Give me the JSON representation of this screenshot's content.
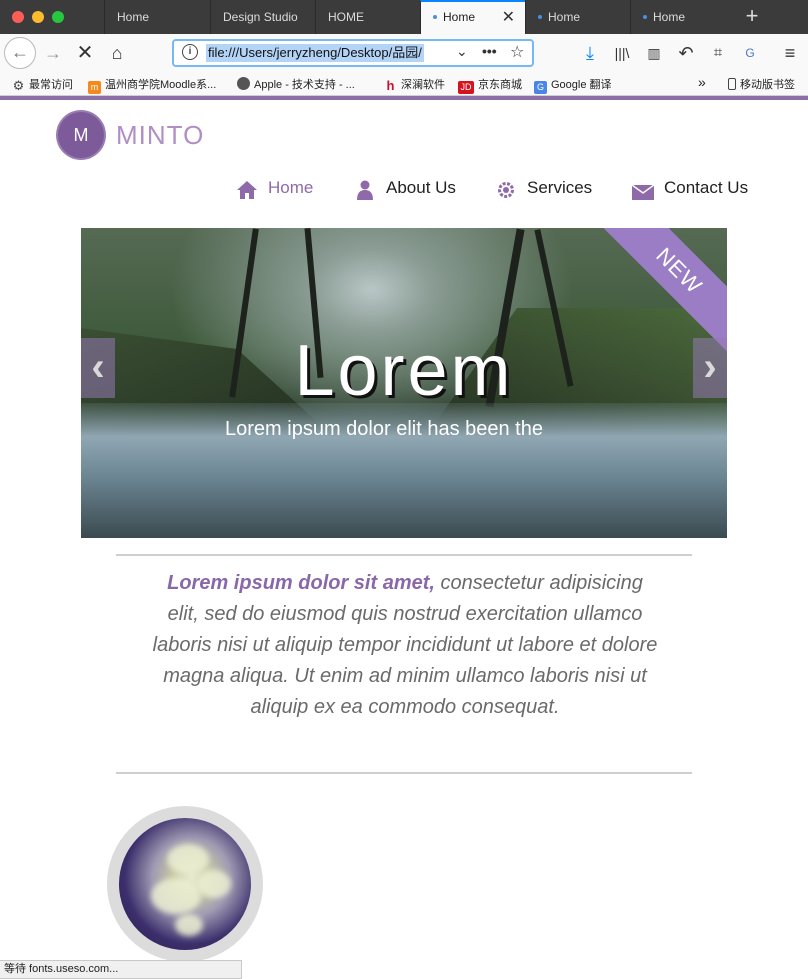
{
  "browser": {
    "tabs": [
      {
        "label": "Home",
        "active": false,
        "dot": false
      },
      {
        "label": "Design Studio",
        "active": false,
        "dot": false
      },
      {
        "label": "HOME",
        "active": false,
        "dot": false
      },
      {
        "label": "Home",
        "active": true,
        "dot": true
      },
      {
        "label": "Home",
        "active": false,
        "dot": true
      },
      {
        "label": "Home",
        "active": false,
        "dot": true
      }
    ],
    "url": "file:///Users/jerryzheng/Desktop/品园/",
    "bookmarks": [
      {
        "label": "最常访问",
        "icon": "gear-icon"
      },
      {
        "label": "温州商学院Moodle系...",
        "icon": "moodle-icon"
      },
      {
        "label": "Apple - 技术支持 - ...",
        "icon": "apple-icon"
      },
      {
        "label": "深澜软件",
        "icon": "h-icon"
      },
      {
        "label": "京东商城",
        "icon": "jd-icon"
      },
      {
        "label": "Google 翻译",
        "icon": "google-translate-icon"
      }
    ],
    "mobile_bookmarks": "移动版书签",
    "status": "等待 fonts.useso.com..."
  },
  "site": {
    "logo_letter": "M",
    "logo_text": "MINTO",
    "nav": [
      {
        "label": "Home",
        "icon": "home-icon",
        "active": true
      },
      {
        "label": "About Us",
        "icon": "user-icon",
        "active": false
      },
      {
        "label": "Services",
        "icon": "gear-icon",
        "active": false
      },
      {
        "label": "Contact Us",
        "icon": "mail-icon",
        "active": false
      }
    ],
    "slider": {
      "ribbon": "NEW",
      "heading": "Lorem",
      "subheading": "Lorem ipsum dolor elit has been the"
    },
    "intro": {
      "lead": "Lorem ipsum dolor sit amet,",
      "text": "consectetur adipisicing elit, sed do eiusmod quis nostrud exercitation ullamco laboris nisi ut aliquip tempor incididunt ut labore et dolore magna aliqua. Ut enim ad minim ullamco laboris nisi ut aliquip ex ea commodo consequat."
    }
  }
}
